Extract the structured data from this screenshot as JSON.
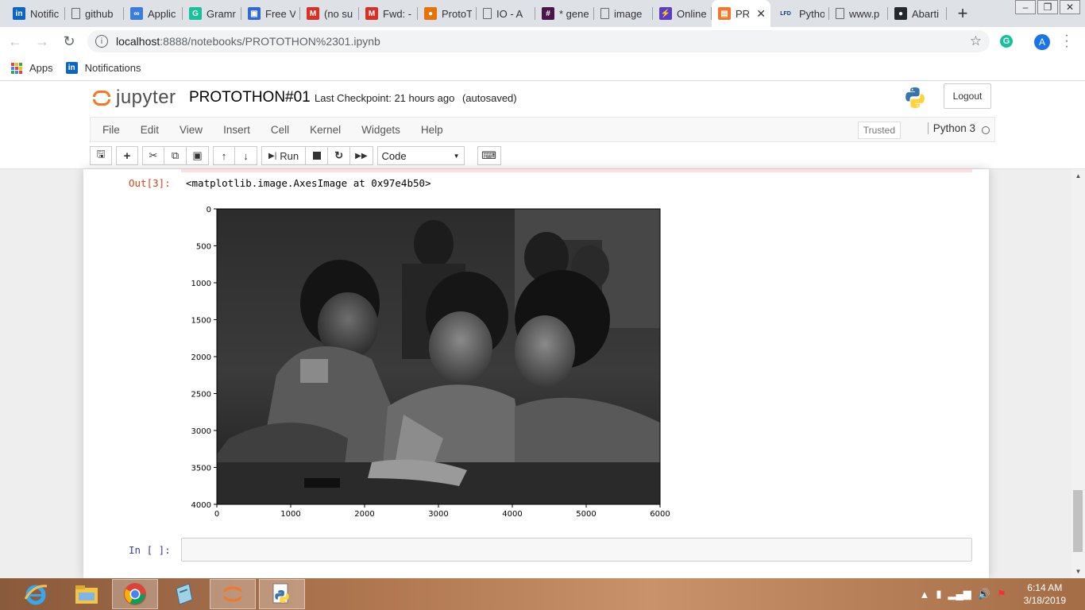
{
  "browser": {
    "tabs": [
      {
        "label": "Notific",
        "favicon": "linkedin-icon",
        "color": "#0a66c2",
        "glyph": "in"
      },
      {
        "label": "github",
        "favicon": "page-icon",
        "color": "",
        "glyph": ""
      },
      {
        "label": "Applic",
        "favicon": "infinity-icon",
        "color": "#3b7ddd",
        "glyph": "∞"
      },
      {
        "label": "Gramr",
        "favicon": "grammarly-icon",
        "color": "#15c39a",
        "glyph": "G"
      },
      {
        "label": "Free V",
        "favicon": "printer-icon",
        "color": "#3367d6",
        "glyph": "▣"
      },
      {
        "label": "(no su",
        "favicon": "gmail-icon",
        "color": "#d93025",
        "glyph": "M"
      },
      {
        "label": "Fwd: -",
        "favicon": "gmail-icon",
        "color": "#d93025",
        "glyph": "M"
      },
      {
        "label": "ProtoT",
        "favicon": "person-icon",
        "color": "#e8710a",
        "glyph": "●"
      },
      {
        "label": "IO - A",
        "favicon": "page-icon",
        "color": "",
        "glyph": ""
      },
      {
        "label": "* gene",
        "favicon": "slack-icon",
        "color": "#4a154b",
        "glyph": "#"
      },
      {
        "label": "image",
        "favicon": "page-icon",
        "color": "",
        "glyph": ""
      },
      {
        "label": "Online",
        "favicon": "bolt-icon",
        "color": "#5b3cc4",
        "glyph": "⚡"
      },
      {
        "label": "PR",
        "favicon": "notebook-icon",
        "color": "#f37726",
        "glyph": "▤",
        "active": true
      },
      {
        "label": "Pytho",
        "favicon": "lfd-icon",
        "color": "",
        "glyph": "LFD"
      },
      {
        "label": "www.p",
        "favicon": "page-icon",
        "color": "",
        "glyph": ""
      },
      {
        "label": "Abarti",
        "favicon": "github-icon",
        "color": "#24292e",
        "glyph": "●"
      }
    ],
    "url_host": "localhost",
    "url_path": ":8888/notebooks/PROTOTHON%2301.ipynb",
    "profile_initial": "A",
    "bookmarks": [
      {
        "label": "Apps",
        "icon": "apps-grid-icon"
      },
      {
        "label": "Notifications",
        "icon": "linkedin-icon"
      }
    ]
  },
  "jupyter": {
    "logo_text": "jupyter",
    "notebook_title": "PROTOTHON#01",
    "checkpoint": "Last Checkpoint: 21 hours ago",
    "autosave": "(autosaved)",
    "logout_label": "Logout",
    "menu": [
      "File",
      "Edit",
      "View",
      "Insert",
      "Cell",
      "Kernel",
      "Widgets",
      "Help"
    ],
    "trusted_label": "Trusted",
    "kernel_name": "Python 3",
    "toolbar": {
      "run_label": "Run",
      "cell_type": "Code"
    }
  },
  "notebook": {
    "out_prompt": "Out[3]:",
    "out_text": "<matplotlib.image.AxesImage at 0x97e4b50>",
    "in_prompt": "In [ ]:"
  },
  "chart_data": {
    "type": "image",
    "x_ticks": [
      "0",
      "1000",
      "2000",
      "3000",
      "4000",
      "5000",
      "6000"
    ],
    "y_ticks": [
      "0",
      "500",
      "1000",
      "1500",
      "2000",
      "2500",
      "3000",
      "3500",
      "4000"
    ],
    "xlim": [
      0,
      6000
    ],
    "ylim": [
      4000,
      0
    ],
    "colormap": "grayscale"
  },
  "taskbar": {
    "apps": [
      "ie-icon",
      "file-explorer-icon",
      "chrome-icon",
      "notepad-icon",
      "jupyter-icon",
      "python-icon"
    ],
    "time": "6:14 AM",
    "date": "3/18/2019"
  }
}
